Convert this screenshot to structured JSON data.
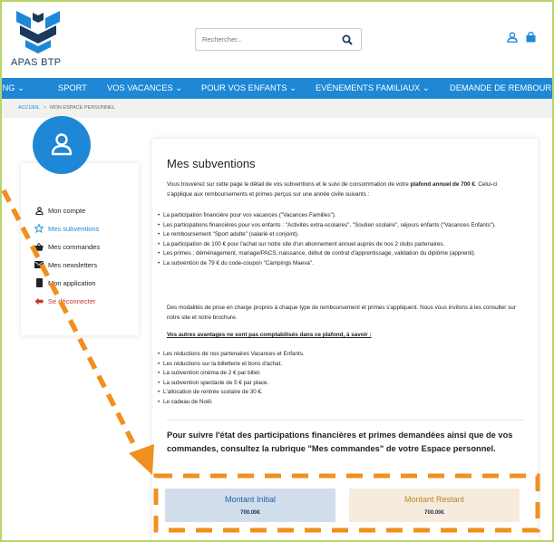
{
  "header": {
    "logo_text": "APAS BTP",
    "search_placeholder": "Rechercher..."
  },
  "nav": {
    "items": [
      "ING",
      "SPORT",
      "VOS VACANCES",
      "POUR VOS ENFANTS",
      "EVÈNEMENTS FAMILIAUX",
      "DEMANDE DE REMBOURS"
    ]
  },
  "breadcrumb": {
    "home": "ACCUEIL",
    "separator": ">",
    "current": "MON ESPACE PERSONNEL"
  },
  "sidebar": {
    "items": [
      {
        "label": "Mon compte",
        "icon": "user-icon"
      },
      {
        "label": "Mes subventions",
        "icon": "star-icon"
      },
      {
        "label": "Mes commandes",
        "icon": "basket-icon"
      },
      {
        "label": "Mes newsletters",
        "icon": "envelope-icon"
      },
      {
        "label": "Mon application",
        "icon": "phone-icon"
      },
      {
        "label": "Se déconnecter",
        "icon": "logout-icon"
      }
    ]
  },
  "main": {
    "title": "Mes subventions",
    "intro_part1": "Vous trouverez sur cette page le détail de vos subventions et le suivi de consommation de votre ",
    "intro_bold": "plafond annuel de 700 €",
    "intro_part2": ". Celui-ci s'applique aux remboursements et primes perçus sur une année civile suivants :",
    "list1": [
      "La participation financière pour vos vacances (\"Vacances Familles\").",
      "Les participations financières pour vos enfants : \"Activités extra-scolaires\", \"Soutien scolaire\", séjours enfants (\"Vacances Enfants\").",
      "Le remboursement \"Sport adulte\" (salarié et conjoint).",
      "La participation de 100 € pour l'achat sur notre site d'un abonnement annuel auprès de nos 2 clubs partenaires.",
      "Les primes : déménagement, mariage/PACS, naissance, début de contrat d'apprentissage, validation du diplôme (apprenti).",
      "La subvention de 79 € du code-coupon \"Campings Maeva\"."
    ],
    "modalities": "Des modalités de prise en charge propres à chaque type de remboursement et primes s'appliquent. Nous vous invitons à les consulter sur notre site et notre brochure.",
    "other_heading": "Vos autres avantages ne sont pas comptabilisés dans ce plafond, à savoir :",
    "list2": [
      "Les réductions de nos partenaires Vacances et Enfants.",
      "Les réductions sur la billetterie et bons d'achat.",
      "La subvention cinéma de 2 € par billet.",
      "La subvention spectacle de 5 € par place.",
      "L'allocation de rentrée scolaire de 30 €.",
      "Le cadeau de Noël."
    ],
    "follow": "Pour suivre l'état des participations financières et primes demandées ainsi que de vos commandes, consultez la rubrique \"Mes commandes\" de votre Espace personnel.",
    "montant_initial_label": "Montant Initial",
    "montant_initial_value": "700.00€",
    "montant_restant_label": "Montant Restant",
    "montant_restant_value": "700.00€"
  },
  "colors": {
    "brand_blue": "#1e88d6",
    "annotation_orange": "#f0901e",
    "frame_green": "#b7d56a",
    "box_initial_bg": "#d3deec",
    "box_restant_bg": "#f6ebdc"
  }
}
